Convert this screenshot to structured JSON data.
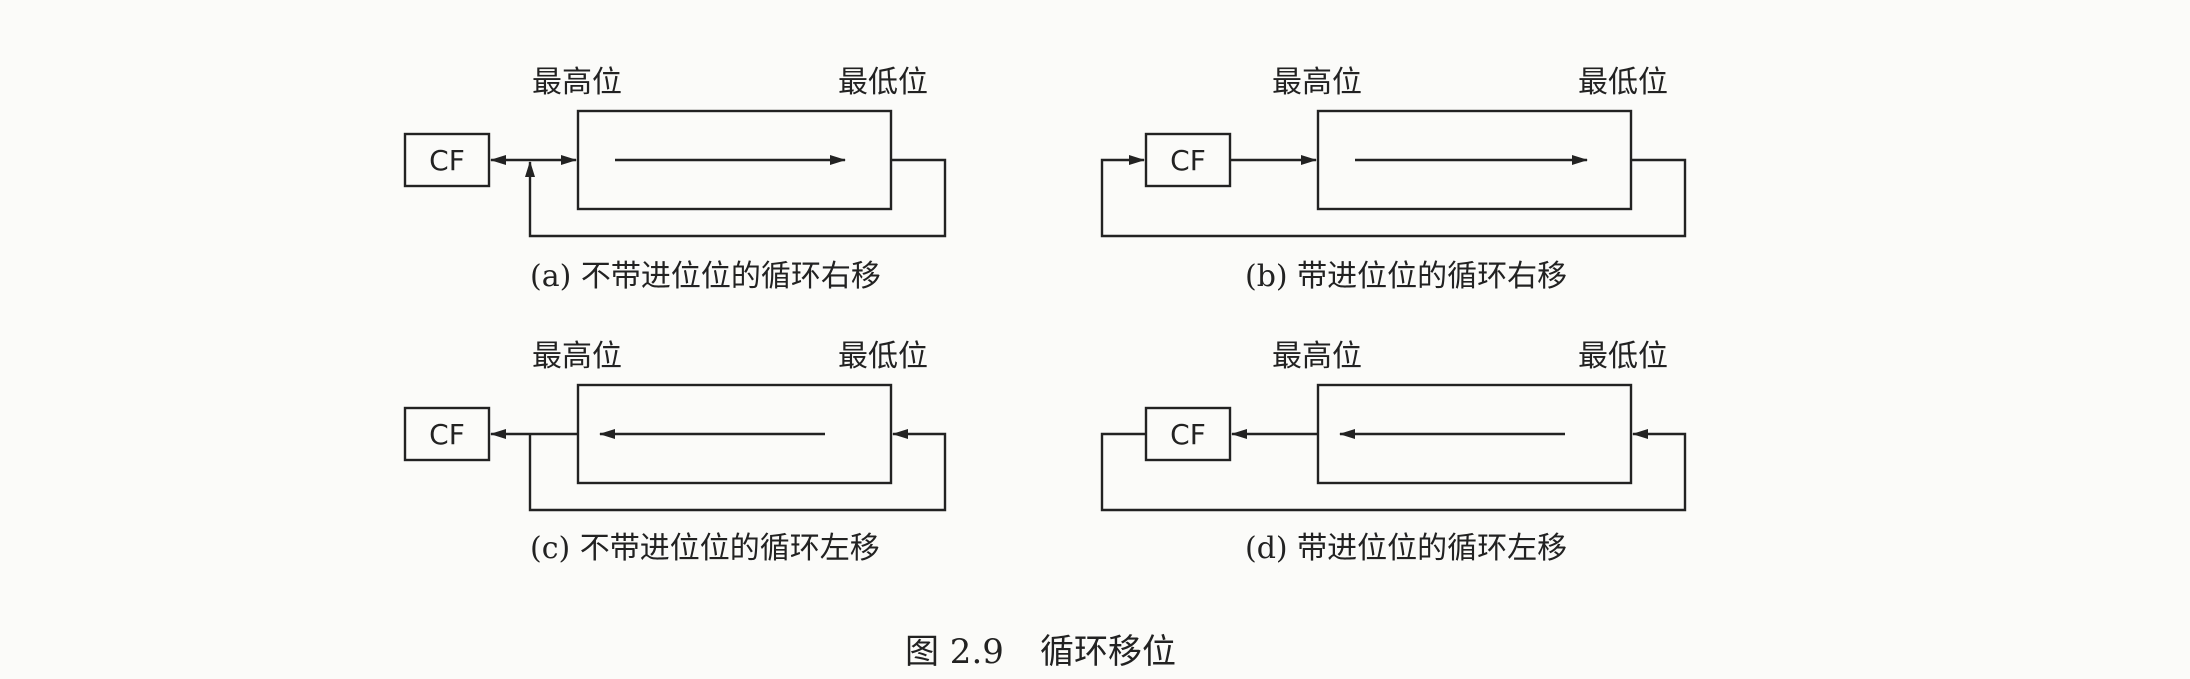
{
  "figure": {
    "caption_number": "图 2.9",
    "caption_title": "循环移位"
  },
  "panels": [
    {
      "id": "a",
      "high_label": "最高位",
      "low_label": "最低位",
      "cf_label": "CF",
      "caption": "(a) 不带进位位的循环右移"
    },
    {
      "id": "b",
      "high_label": "最高位",
      "low_label": "最低位",
      "cf_label": "CF",
      "caption": "(b) 带进位位的循环右移"
    },
    {
      "id": "c",
      "high_label": "最高位",
      "low_label": "最低位",
      "cf_label": "CF",
      "caption": "(c) 不带进位位的循环左移"
    },
    {
      "id": "d",
      "high_label": "最高位",
      "low_label": "最低位",
      "cf_label": "CF",
      "caption": "(d) 带进位位的循环左移"
    }
  ],
  "colors": {
    "ink": "#222222",
    "paper": "#fbfbf9"
  }
}
